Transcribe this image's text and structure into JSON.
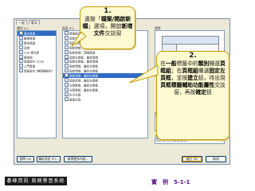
{
  "dialog": {
    "tab_labels": [
      "一般",
      "範本"
    ],
    "category_title": "類別 (C):",
    "page_title": "頁面 (P):",
    "preview_title": "預覽",
    "desc_title": "描述:",
    "categories": [
      {
        "label": "基本頁面",
        "selected": true
      },
      {
        "label": "動態頁面",
        "selected": false
      },
      {
        "label": "範本頁面",
        "selected": false
      },
      {
        "label": "其他",
        "selected": false
      },
      {
        "label": "CSS 樣式表",
        "selected": false
      },
      {
        "label": "框架組",
        "selected": false
      },
      {
        "label": "頁面設計 (CSS)",
        "selected": false
      },
      {
        "label": "入門頁面",
        "selected": false
      },
      {
        "label": "頁面設計 (無障礙設計)",
        "selected": false
      }
    ],
    "pages": [
      {
        "label": "頁面組合：入門頁面",
        "selected": false
      },
      {
        "label": "固定左頁框，頂端頁面",
        "selected": false
      },
      {
        "label": "固定右頁框，頂端頁面",
        "selected": false
      },
      {
        "label": "固定頂端，頂端頁面",
        "selected": false
      },
      {
        "label": "固定底端，頂端頁面",
        "selected": false
      },
      {
        "label": "固定左頁框，巢狀頂端",
        "selected": false
      },
      {
        "label": "固定右頁框，巢狀頂端",
        "selected": false
      },
      {
        "label": "固定頂端，巢狀左頁框",
        "selected": false
      },
      {
        "label": "固定頂端，巢狀右頁框",
        "selected": false
      },
      {
        "label": "固定底端，巢狀左頁框",
        "selected": true
      },
      {
        "label": "固定底端，巢狀右頁框",
        "selected": false
      },
      {
        "label": "分割頁框，巢狀左頁框",
        "selected": false
      },
      {
        "label": "分割頁框，巢狀右頁框",
        "selected": false
      },
      {
        "label": "水平分割",
        "selected": false
      },
      {
        "label": "垂直分割",
        "selected": false
      }
    ],
    "desc_text": "以固定大小的頂端頁框及巢狀的左頁框建立的頁框組",
    "doctype_label": "文件類型 (DTD):",
    "doctype_value": "XHTML 1.0 Transitional",
    "buttons": {
      "help": "說明 (H)",
      "prefs": "偏好設定 (P)...",
      "more": "取得更多內容...",
      "create": "建立 (R)",
      "cancel": "取消"
    }
  },
  "callout1": {
    "num": "1.",
    "text_a": "選按「",
    "text_b": "檔案/開啟新檔",
    "text_c": "」選項，開啟",
    "text_d": "新增文件",
    "text_e": "交談窗"
  },
  "callout2": {
    "num": "2.",
    "text_a": "在",
    "text_b": "一般",
    "text_c": "標籤中的",
    "text_d": "類別",
    "text_e": "欄選",
    "text_f": "頁框組",
    "text_g": "；在",
    "text_h": "頁框組",
    "text_i": "欄選",
    "text_j": "固定左頁框",
    "text_k": "，並按",
    "text_l": "建立",
    "text_m": "鈕，待出現",
    "text_n": "頁框標籤輔助功能屬性",
    "text_o": "交談窗，再按",
    "text_p": "確定",
    "text_q": "鈕"
  },
  "footer": {
    "left": "碁峰資訊 商務學習系統",
    "right": "實　例　5-1-1"
  }
}
